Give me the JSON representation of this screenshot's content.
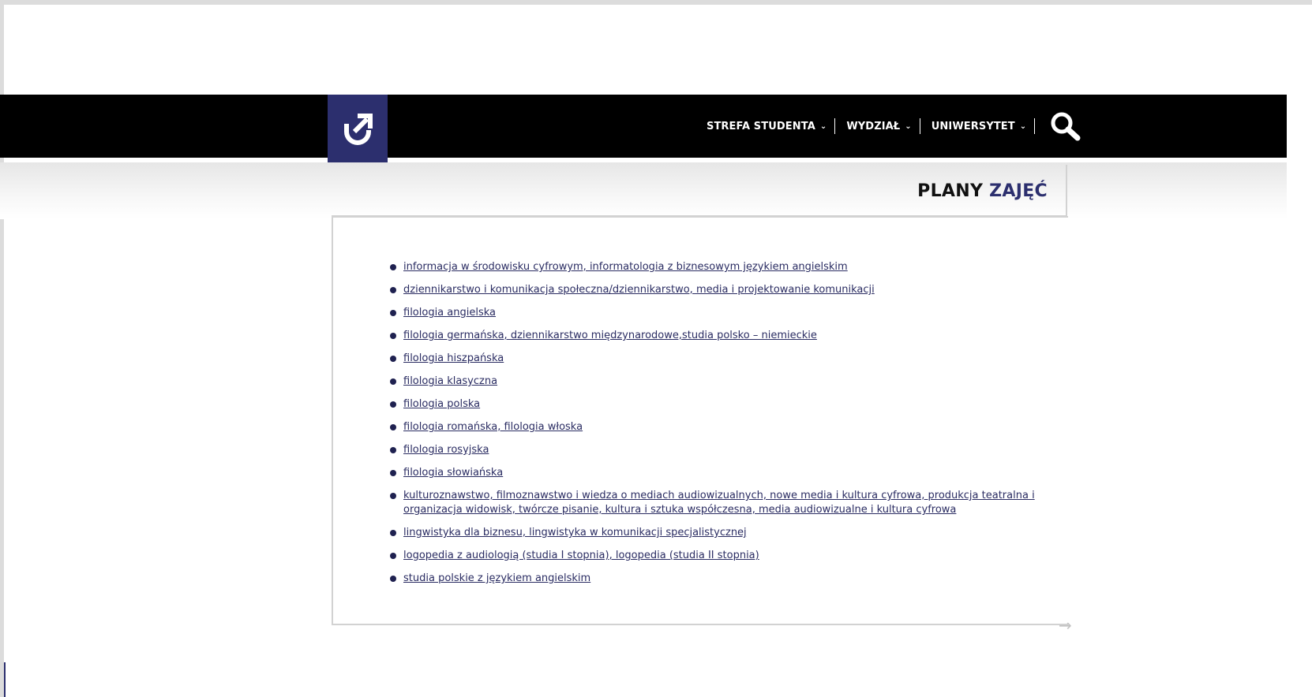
{
  "header": {
    "logo_icon": "arrow-up-right-u-icon",
    "nav": [
      {
        "label": "STREFA STUDENTA"
      },
      {
        "label": "WYDZIAŁ"
      },
      {
        "label": "UNIWERSYTET"
      }
    ],
    "search_icon": "search-icon"
  },
  "colors": {
    "brand": "#2c2f6e",
    "header_bg": "#000000",
    "link": "#2a2c62"
  },
  "page": {
    "title_part1": "PLANY",
    "title_part2": "ZAJĘĆ"
  },
  "links": [
    {
      "label": "informacja w środowisku cyfrowym, informatologia z biznesowym językiem angielskim"
    },
    {
      "label": "dziennikarstwo i komunikacja społeczna/dziennikarstwo, media i projektowanie komunikacji"
    },
    {
      "label": "filologia angielska"
    },
    {
      "label": "filologia germańska, dziennikarstwo międzynarodowe,studia polsko – niemieckie"
    },
    {
      "label": "filologia hiszpańska"
    },
    {
      "label": "filologia klasyczna"
    },
    {
      "label": "filologia polska"
    },
    {
      "label": "filologia romańska, filologia włoska"
    },
    {
      "label": "filologia rosyjska"
    },
    {
      "label": "filologia słowiańska"
    },
    {
      "label": "kulturoznawstwo, filmoznawstwo i wiedza o mediach audiowizualnych, nowe media i kultura cyfrowa, produkcja teatralna i organizacja widowisk, twórcze pisanie, kultura i sztuka współczesna, media audiowizualne i kultura cyfrowa"
    },
    {
      "label": "lingwistyka dla biznesu, lingwistyka w komunikacji specjalistycznej"
    },
    {
      "label": "logopedia z audiologią (studia I stopnia), logopedia (studia II stopnia)"
    },
    {
      "label": "studia polskie z językiem angielskim"
    }
  ]
}
